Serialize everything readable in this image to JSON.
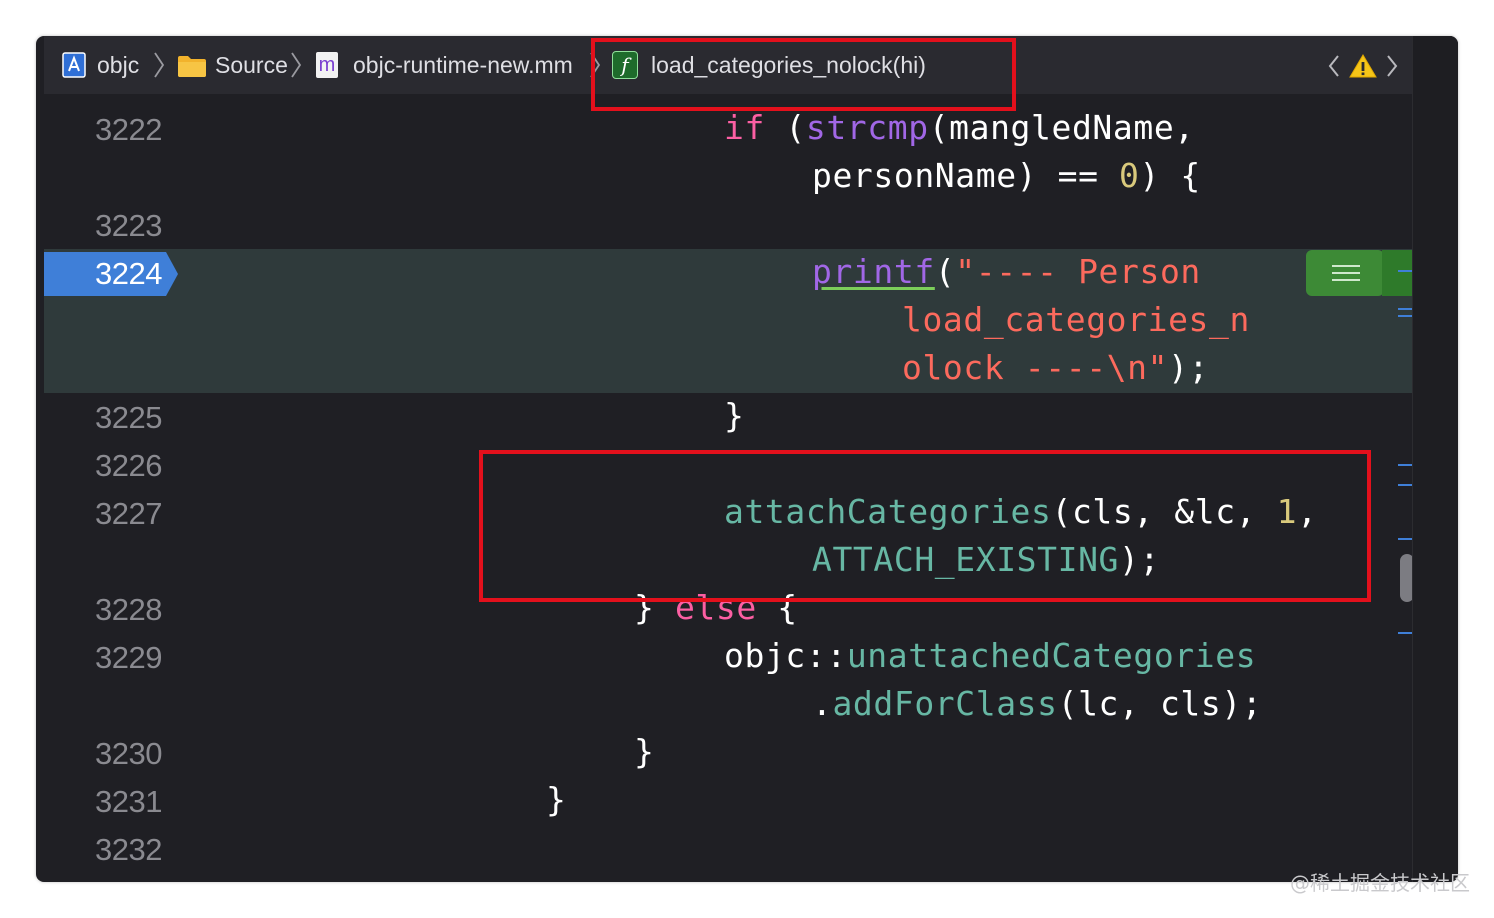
{
  "breadcrumb": {
    "items": [
      {
        "label": "objc",
        "icon": "project-icon"
      },
      {
        "label": "Source",
        "icon": "folder-icon"
      },
      {
        "label": "objc-runtime-new.mm",
        "icon": "objc-file-icon",
        "icon_letter": "m"
      },
      {
        "label": "load_categories_nolock(hi)",
        "icon": "function-icon",
        "icon_letter": "f"
      }
    ]
  },
  "navigation": {
    "back": "back-arrow-icon",
    "warning": "warning-icon",
    "forward": "forward-arrow-icon"
  },
  "editor": {
    "line_numbers": [
      "3222",
      "3223",
      "3224",
      "3225",
      "3226",
      "3227",
      "3228",
      "3229",
      "3230",
      "3231",
      "3232"
    ],
    "active_line": "3224",
    "code": {
      "l3222a_kw": "if",
      "l3222a_fn": "strcmp",
      "l3222a_rest": "(mangledName,",
      "l3222b_pre": "personName) == ",
      "l3222b_num": "0",
      "l3222b_post": ") {",
      "l3224a_fn": "printf",
      "l3224a_paren": "(",
      "l3224a_str": "\"---- Person",
      "l3224b_str": "load_categories_n",
      "l3224c_str": "olock ----\\n\"",
      "l3224c_post": ");",
      "l3225": "}",
      "l3227a_call": "attachCategories",
      "l3227a_args": "(cls, &lc, ",
      "l3227a_num": "1",
      "l3227a_comma": ",",
      "l3227b_call": "ATTACH_EXISTING",
      "l3227b_post": ");",
      "l3228_pre": "} ",
      "l3228_kw": "else",
      "l3228_post": " {",
      "l3229a_ns": "objc::",
      "l3229a_call": "unattachedCategories",
      "l3229b_dot": ".",
      "l3229b_call": "addForClass",
      "l3229b_args": "(lc, cls);",
      "l3230": "}",
      "l3231": "}"
    }
  },
  "colors": {
    "highlight_box": "#e3101c",
    "active_line_badge": "#3f7fd8",
    "keyword": "#fc5fa3",
    "function": "#a167e6",
    "string": "#fc6a5d",
    "number": "#d9c97c",
    "project_call": "#67b7a4"
  },
  "watermark": "@稀土掘金技术社区"
}
